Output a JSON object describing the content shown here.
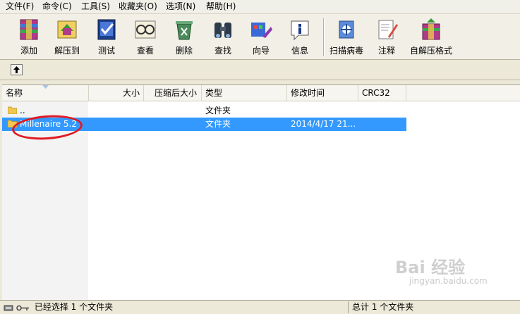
{
  "menu": [
    "文件(F)",
    "命令(C)",
    "工具(S)",
    "收藏夹(O)",
    "选项(N)",
    "帮助(H)"
  ],
  "toolbar": {
    "add": "添加",
    "extract": "解压到",
    "test": "测试",
    "view": "查看",
    "delete": "删除",
    "find": "查找",
    "wizard": "向导",
    "info": "信息",
    "scan": "扫描病毒",
    "comment": "注释",
    "sfx": "自解压格式"
  },
  "columns": {
    "name": "名称",
    "size": "大小",
    "packed": "压缩后大小",
    "type": "类型",
    "modified": "修改时间",
    "crc": "CRC32"
  },
  "rows": [
    {
      "name": "..",
      "type": "文件夹",
      "modified": ""
    },
    {
      "name": "Millenaire 5.2",
      "type": "文件夹",
      "modified": "2014/4/17 21..."
    }
  ],
  "status": {
    "left": "已经选择 1 个文件夹",
    "right": "总计 1 个文件夹"
  },
  "watermark": {
    "main": "Bai 经验",
    "sub": "jingyan.baidu.com"
  },
  "colors": {
    "selection": "#3399ff",
    "annotation": "#e11b22"
  }
}
